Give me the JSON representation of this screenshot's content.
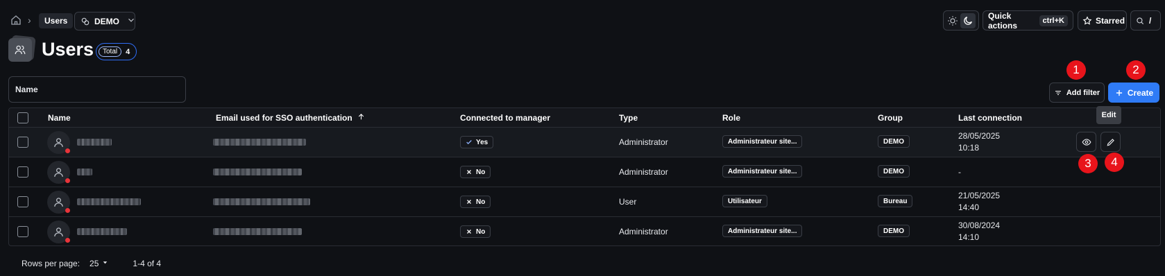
{
  "breadcrumb": {
    "current": "Users",
    "workspace": "DEMO"
  },
  "header": {
    "quick_actions_label": "Quick actions",
    "quick_actions_shortcut": "ctrl+K",
    "starred_label": "Starred",
    "search_shortcut": "/"
  },
  "page": {
    "title": "Users",
    "total_label": "Total",
    "total_count": "4"
  },
  "filters": {
    "name_placeholder": "Name",
    "add_filter_label": "Add filter",
    "create_label": "Create"
  },
  "table": {
    "columns": {
      "name": "Name",
      "email": "Email used for SSO authentication",
      "connected": "Connected to manager",
      "type": "Type",
      "role": "Role",
      "group": "Group",
      "last_connection": "Last connection"
    },
    "rows": [
      {
        "connected": "Yes",
        "type": "Administrator",
        "role": "Administrateur site...",
        "group": "DEMO",
        "last_date": "28/05/2025",
        "last_time": "10:18"
      },
      {
        "connected": "No",
        "type": "Administrator",
        "role": "Administrateur site...",
        "group": "DEMO",
        "last_date": "-",
        "last_time": ""
      },
      {
        "connected": "No",
        "type": "User",
        "role": "Utilisateur",
        "group": "Bureau",
        "last_date": "21/05/2025",
        "last_time": "14:40"
      },
      {
        "connected": "No",
        "type": "Administrator",
        "role": "Administrateur site...",
        "group": "DEMO",
        "last_date": "30/08/2024",
        "last_time": "14:10"
      }
    ]
  },
  "tooltip": "Edit",
  "markers": [
    "1",
    "2",
    "3",
    "4"
  ],
  "pagination": {
    "rows_per_page_label": "Rows per page:",
    "rows_per_page": "25",
    "range": "1-4 of 4"
  },
  "colors": {
    "accent": "#2f7bf6",
    "marker": "#e8141b",
    "status_offline": "#e8343a"
  }
}
